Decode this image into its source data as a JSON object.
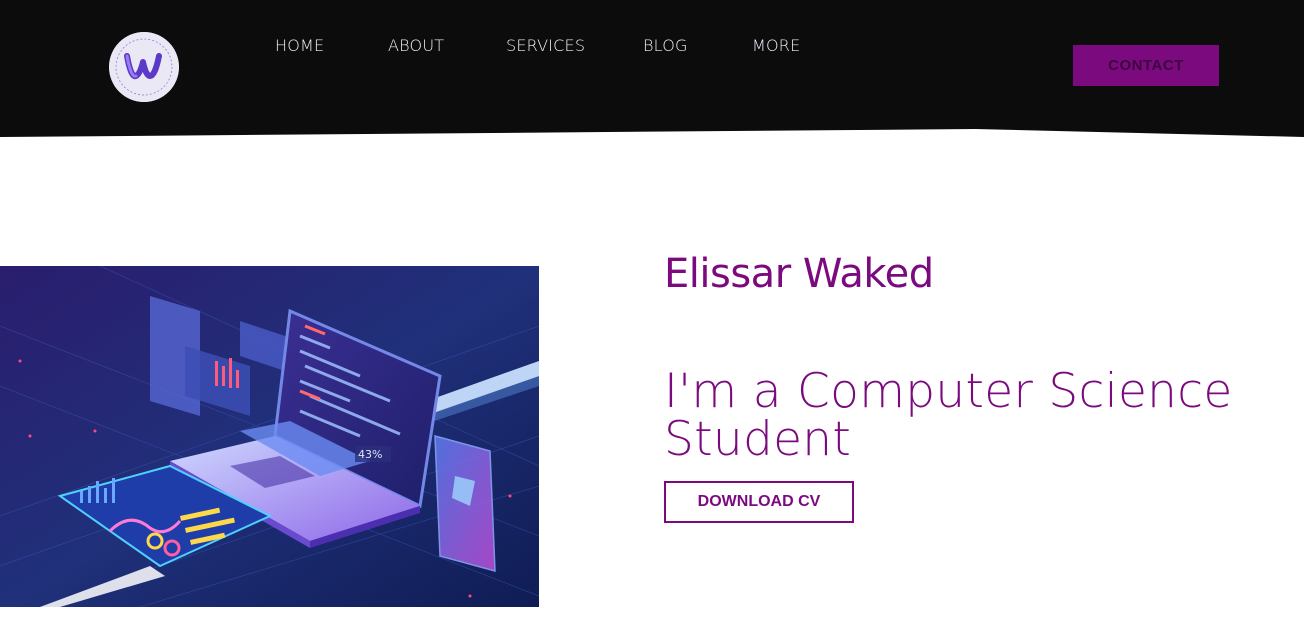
{
  "header": {
    "logo_alt": "W development logo",
    "nav": [
      "HOME",
      "ABOUT",
      "SERVICES",
      "BLOG",
      "MORE"
    ],
    "contact_label": "CONTACT"
  },
  "hero": {
    "name": "Elissar Waked",
    "tagline": "I'm a Computer Science Student",
    "cv_button": "DOWNLOAD CV",
    "image_percent_label": "43%"
  },
  "colors": {
    "brand": "#7b0a7f",
    "header_bg": "#0c0c0d"
  }
}
